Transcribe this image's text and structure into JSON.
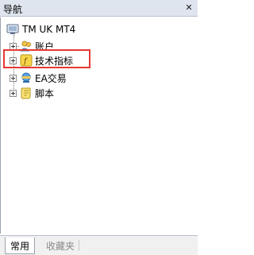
{
  "panel": {
    "title": "导航",
    "close_symbol": "✕"
  },
  "tree": {
    "root": {
      "label": "TM UK MT4",
      "icon": "terminal-icon"
    },
    "items": [
      {
        "label": "账户",
        "icon": "accounts-icon"
      },
      {
        "label": "技术指标",
        "icon": "indicator-icon",
        "highlighted": true
      },
      {
        "label": "EA交易",
        "icon": "expert-advisor-icon"
      },
      {
        "label": "脚本",
        "icon": "script-icon"
      }
    ]
  },
  "tabs": [
    {
      "label": "常用",
      "active": true
    },
    {
      "label": "收藏夹",
      "active": false
    }
  ],
  "colors": {
    "highlight_border": "#e53935",
    "title_bg": "#dfe5ee"
  }
}
